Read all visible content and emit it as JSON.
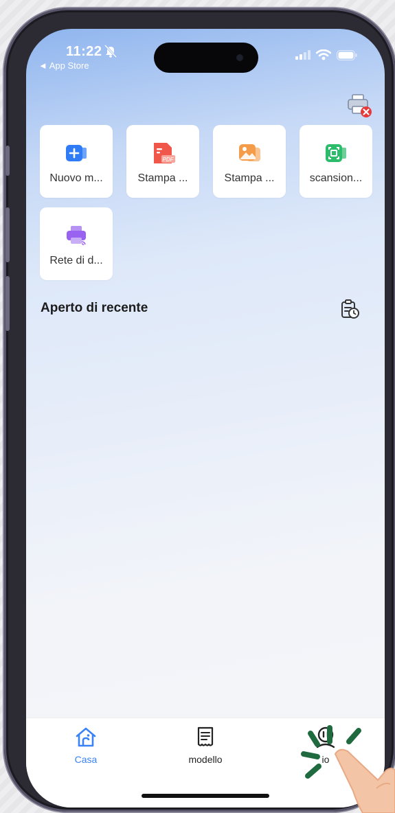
{
  "status_bar": {
    "time": "11:22",
    "back_label": "◄ App Store",
    "icons": [
      "bell-slash-icon",
      "signal-icon",
      "wifi-icon",
      "battery-icon"
    ]
  },
  "header": {
    "icon": "printer-disconnected-icon"
  },
  "tiles": [
    {
      "label": "Nuovo m...",
      "icon": "new-document-icon",
      "color": "#2f7cf6"
    },
    {
      "label": "Stampa ...",
      "icon": "pdf-icon",
      "color": "#f0564a"
    },
    {
      "label": "Stampa ...",
      "icon": "photo-icon",
      "color": "#f59c4a"
    },
    {
      "label": "scansion...",
      "icon": "scan-icon",
      "color": "#2dbb6c"
    },
    {
      "label": "Rete di d...",
      "icon": "network-printer-icon",
      "color": "#9a62f0"
    }
  ],
  "recent": {
    "title": "Aperto di recente",
    "icon": "clipboard-history-icon"
  },
  "tabbar": {
    "items": [
      {
        "label": "Casa",
        "icon": "home-icon",
        "active": true,
        "color": "#3b82f6"
      },
      {
        "label": "modello",
        "icon": "template-icon",
        "active": false,
        "color": "#222222"
      },
      {
        "label": "io",
        "icon": "profile-icon",
        "active": false,
        "color": "#222222"
      }
    ]
  },
  "overlay": {
    "icon": "tap-hand-icon",
    "accent": "#1f6b3f"
  }
}
